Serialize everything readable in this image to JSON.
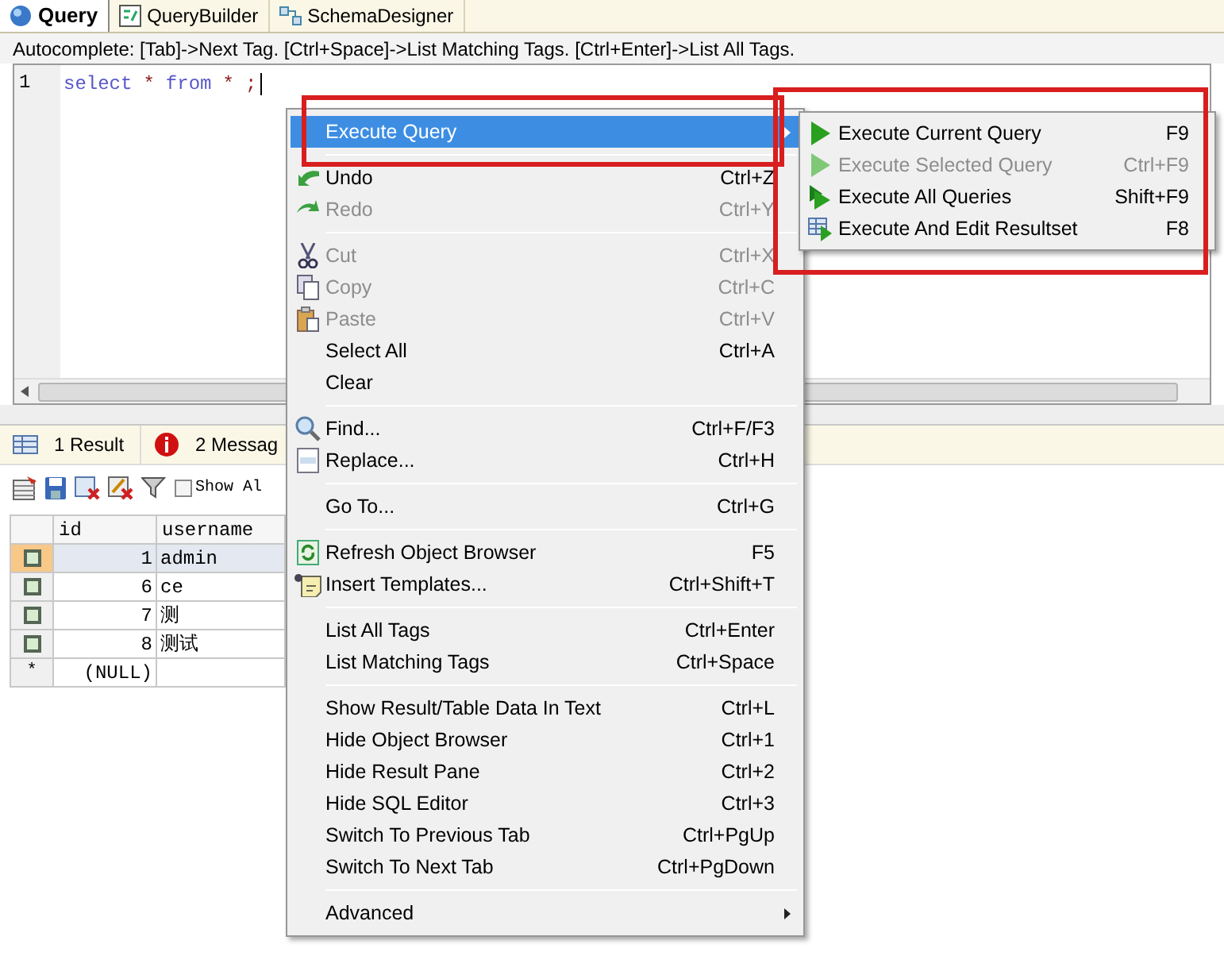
{
  "tabs": [
    {
      "label": "Query",
      "selected": true
    },
    {
      "label": "QueryBuilder",
      "selected": false
    },
    {
      "label": "SchemaDesigner",
      "selected": false
    }
  ],
  "autocomplete_hint": "Autocomplete: [Tab]->Next Tag. [Ctrl+Space]->List Matching Tags. [Ctrl+Enter]->List All Tags.",
  "editor": {
    "line_number": "1",
    "tokens": [
      {
        "kind": "keyword",
        "text": "select"
      },
      {
        "kind": "operator",
        "text": "*"
      },
      {
        "kind": "keyword",
        "text": "from"
      },
      {
        "kind": "operator",
        "text": "*"
      },
      {
        "kind": "operator",
        "text": ";"
      }
    ]
  },
  "result_tabs": [
    {
      "label": "1 Result"
    },
    {
      "label": "2 Messag"
    }
  ],
  "result_toolbar": {
    "checkbox": {
      "label": "Show Al",
      "checked": false
    }
  },
  "grid": {
    "columns": [
      "id",
      "username"
    ],
    "rows": [
      {
        "kind": "record",
        "cells": [
          "1",
          "admin"
        ],
        "selected": true
      },
      {
        "kind": "record",
        "cells": [
          "6",
          "ce"
        ],
        "selected": false
      },
      {
        "kind": "record",
        "cells": [
          "7",
          "测"
        ],
        "selected": false
      },
      {
        "kind": "record",
        "cells": [
          "8",
          "测试"
        ],
        "selected": false
      },
      {
        "kind": "new",
        "marker": "*",
        "cells": [
          "(NULL)"
        ],
        "selected": false
      }
    ]
  },
  "context_menu": {
    "items": [
      {
        "kind": "item",
        "label": "Execute Query",
        "selected": true,
        "disabled": false,
        "submenu": true
      },
      {
        "kind": "separator"
      },
      {
        "kind": "item",
        "label": "Undo",
        "shortcut": "Ctrl+Z",
        "selected": false,
        "disabled": false,
        "submenu": false
      },
      {
        "kind": "item",
        "label": "Redo",
        "shortcut": "Ctrl+Y",
        "selected": false,
        "disabled": true,
        "submenu": false
      },
      {
        "kind": "separator"
      },
      {
        "kind": "item",
        "label": "Cut",
        "shortcut": "Ctrl+X",
        "selected": false,
        "disabled": true,
        "submenu": false
      },
      {
        "kind": "item",
        "label": "Copy",
        "shortcut": "Ctrl+C",
        "selected": false,
        "disabled": true,
        "submenu": false
      },
      {
        "kind": "item",
        "label": "Paste",
        "shortcut": "Ctrl+V",
        "selected": false,
        "disabled": true,
        "submenu": false
      },
      {
        "kind": "item",
        "label": "Select All",
        "shortcut": "Ctrl+A",
        "selected": false,
        "disabled": false,
        "submenu": false
      },
      {
        "kind": "item",
        "label": "Clear",
        "selected": false,
        "disabled": false,
        "submenu": false
      },
      {
        "kind": "separator"
      },
      {
        "kind": "item",
        "label": "Find...",
        "shortcut": "Ctrl+F/F3",
        "selected": false,
        "disabled": false,
        "submenu": false
      },
      {
        "kind": "item",
        "label": "Replace...",
        "shortcut": "Ctrl+H",
        "selected": false,
        "disabled": false,
        "submenu": false
      },
      {
        "kind": "separator"
      },
      {
        "kind": "item",
        "label": "Go To...",
        "shortcut": "Ctrl+G",
        "selected": false,
        "disabled": false,
        "submenu": false
      },
      {
        "kind": "separator"
      },
      {
        "kind": "item",
        "label": "Refresh Object Browser",
        "shortcut": "F5",
        "selected": false,
        "disabled": false,
        "submenu": false
      },
      {
        "kind": "item",
        "label": "Insert Templates...",
        "shortcut": "Ctrl+Shift+T",
        "selected": false,
        "disabled": false,
        "submenu": false
      },
      {
        "kind": "separator"
      },
      {
        "kind": "item",
        "label": "List All Tags",
        "shortcut": "Ctrl+Enter",
        "selected": false,
        "disabled": false,
        "submenu": false
      },
      {
        "kind": "item",
        "label": "List Matching Tags",
        "shortcut": "Ctrl+Space",
        "selected": false,
        "disabled": false,
        "submenu": false
      },
      {
        "kind": "separator"
      },
      {
        "kind": "item",
        "label": "Show Result/Table Data In Text",
        "shortcut": "Ctrl+L",
        "selected": false,
        "disabled": false,
        "submenu": false
      },
      {
        "kind": "item",
        "label": "Hide Object Browser",
        "shortcut": "Ctrl+1",
        "selected": false,
        "disabled": false,
        "submenu": false
      },
      {
        "kind": "item",
        "label": "Hide Result Pane",
        "shortcut": "Ctrl+2",
        "selected": false,
        "disabled": false,
        "submenu": false
      },
      {
        "kind": "item",
        "label": "Hide SQL Editor",
        "shortcut": "Ctrl+3",
        "selected": false,
        "disabled": false,
        "submenu": false
      },
      {
        "kind": "item",
        "label": "Switch To Previous Tab",
        "shortcut": "Ctrl+PgUp",
        "selected": false,
        "disabled": false,
        "submenu": false
      },
      {
        "kind": "item",
        "label": "Switch To Next Tab",
        "shortcut": "Ctrl+PgDown",
        "selected": false,
        "disabled": false,
        "submenu": false
      },
      {
        "kind": "separator"
      },
      {
        "kind": "item",
        "label": "Advanced",
        "selected": false,
        "disabled": false,
        "submenu": true
      }
    ]
  },
  "submenu": {
    "items": [
      {
        "label": "Execute Current Query",
        "shortcut": "F9",
        "disabled": false
      },
      {
        "label": "Execute Selected Query",
        "shortcut": "Ctrl+F9",
        "disabled": true
      },
      {
        "label": "Execute All Queries",
        "shortcut": "Shift+F9",
        "disabled": false
      },
      {
        "label": "Execute And Edit Resultset",
        "shortcut": "F8",
        "disabled": false
      }
    ]
  },
  "annotations": [
    {
      "kind": "box"
    },
    {
      "kind": "box"
    }
  ]
}
